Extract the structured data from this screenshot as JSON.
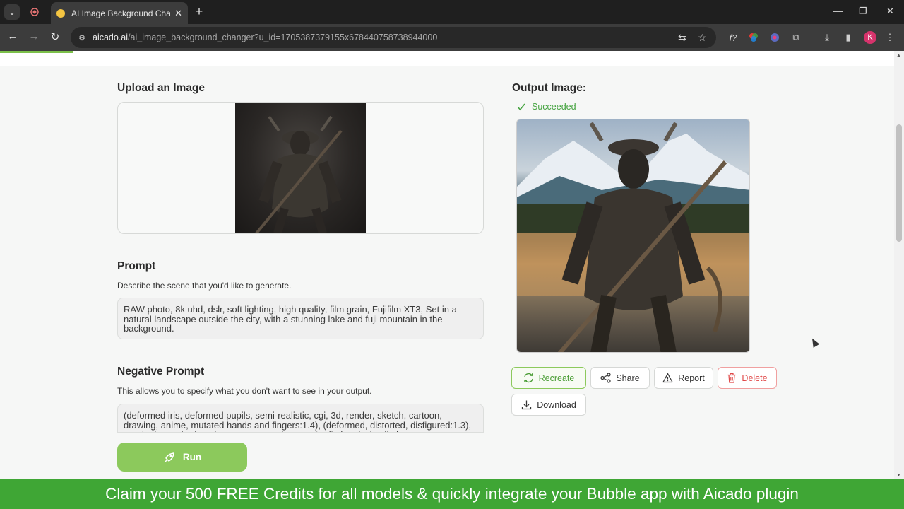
{
  "browser": {
    "tab_title": "AI Image Background Changer",
    "url_host": "aicado.ai",
    "url_path": "/ai_image_background_changer?u_id=1705387379155x678440758738944000",
    "profile_initial": "K"
  },
  "upload": {
    "title": "Upload an Image"
  },
  "prompt": {
    "title": "Prompt",
    "description": "Describe the scene that you'd like to generate.",
    "value": "RAW photo, 8k uhd, dslr, soft lighting, high quality, film grain, Fujifilm XT3, Set in a natural landscape outside the city, with a stunning lake and fuji mountain in the background."
  },
  "negative_prompt": {
    "title": "Negative Prompt",
    "description": "This allows you to specify what you don't want to see in your output.",
    "value": "(deformed iris, deformed pupils, semi-realistic, cgi, 3d, render, sketch, cartoon, drawing, anime, mutated hands and fingers:1.4), (deformed, distorted, disfigured:1.3), poorly drawn, bad anatomy, wrong anatomy, extra limb, missing limb"
  },
  "run_label": "Run",
  "output": {
    "title": "Output Image:",
    "status": "Succeeded",
    "actions": {
      "recreate": "Recreate",
      "share": "Share",
      "report": "Report",
      "delete": "Delete",
      "download": "Download"
    }
  },
  "banner": "Claim your 500 FREE Credits for all models & quickly integrate your Bubble app with Aicado plugin",
  "colors": {
    "accent_green": "#8cc95c",
    "banner_green": "#3fa635",
    "success_green": "#45a340",
    "delete_red": "#e04848"
  }
}
